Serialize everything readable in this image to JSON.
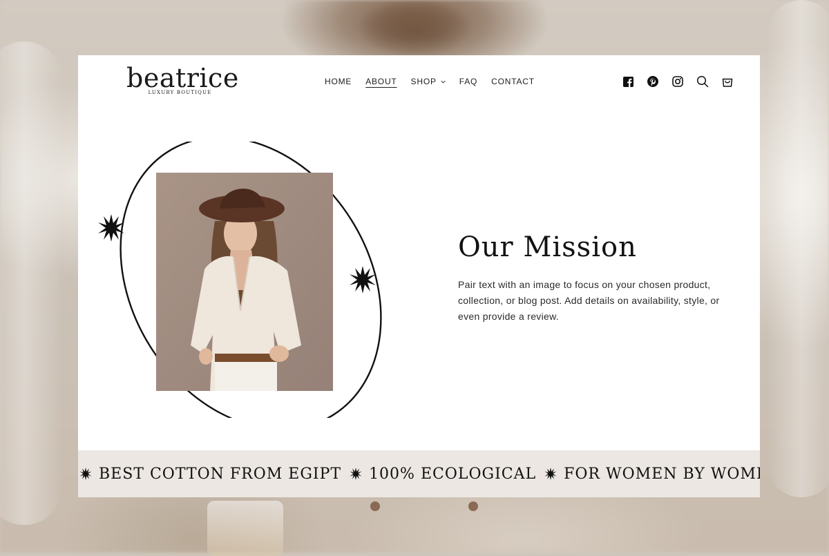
{
  "brand": {
    "name": "beatrice",
    "tagline": "LUXURY BOUTIQUE"
  },
  "nav": {
    "items": [
      {
        "label": "HOME",
        "active": false
      },
      {
        "label": "ABOUT",
        "active": true
      },
      {
        "label": "SHOP",
        "active": false,
        "dropdown": true
      },
      {
        "label": "FAQ",
        "active": false
      },
      {
        "label": "CONTACT",
        "active": false
      }
    ]
  },
  "header_icons": [
    "facebook-icon",
    "pinterest-icon",
    "instagram-icon",
    "search-icon",
    "cart-icon"
  ],
  "hero": {
    "title": "Our Mission",
    "body": "Pair text with an image to focus on your chosen product, collection, or blog post. Add details on availability, style, or even provide a review."
  },
  "marquee": {
    "items": [
      "BEST COTTON FROM EGIPT",
      "100% ECOLOGICAL",
      "FOR WOMEN BY WOMEN"
    ]
  },
  "colors": {
    "card_bg": "#ffffff",
    "text": "#121212",
    "marquee_bg": "#ece7e2",
    "page_bg": "#cfc6bb"
  }
}
